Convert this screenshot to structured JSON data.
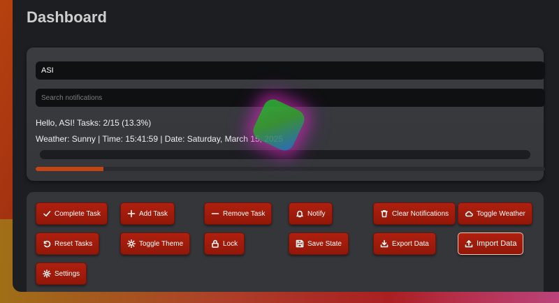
{
  "app": {
    "title": "Dashboard"
  },
  "status": {
    "name_value": "ASI",
    "search_placeholder": "Search notifications",
    "greeting": "Hello, ASI! Tasks: 2/15 (13.3%)",
    "info": "Weather: Sunny | Time: 15:41:59 | Date: Saturday, March 15, 2025",
    "progress_fraction": 0.133
  },
  "actions": {
    "complete_task": "Complete Task",
    "add_task": "Add Task",
    "remove_task": "Remove Task",
    "notify": "Notify",
    "clear_notifications": "Clear Notifications",
    "toggle_weather": "Toggle Weather",
    "reset_tasks": "Reset Tasks",
    "toggle_theme": "Toggle Theme",
    "lock": "Lock",
    "save_state": "Save State",
    "export_data": "Export Data",
    "import_data": "Import Data",
    "settings": "Settings"
  },
  "icons": {
    "complete_task": "check-icon",
    "add_task": "plus-icon",
    "remove_task": "minus-icon",
    "notify": "bell-icon",
    "clear_notifications": "trash-icon",
    "toggle_weather": "cloud-icon",
    "reset_tasks": "rotate-icon",
    "toggle_theme": "sun-icon",
    "lock": "lock-icon",
    "save_state": "floppy-icon",
    "export_data": "download-icon",
    "import_data": "upload-icon",
    "settings": "gear-icon"
  },
  "colors": {
    "accent": "#c64312",
    "button": "#a51c0c",
    "panel": "#34363a",
    "input_bg": "#0f1011"
  }
}
